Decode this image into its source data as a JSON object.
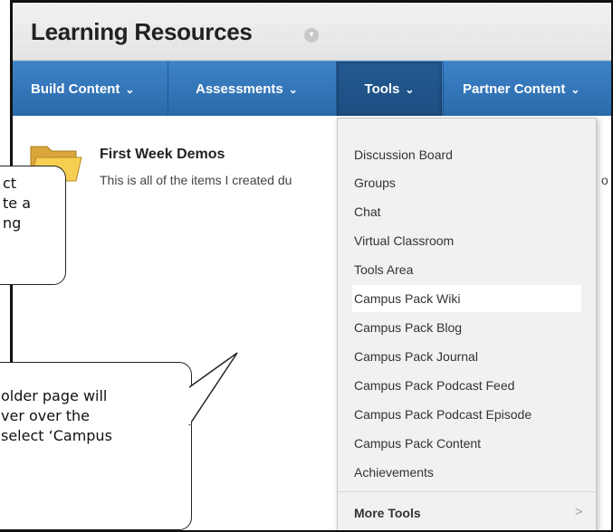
{
  "header": {
    "title": "Learning Resources"
  },
  "nav": {
    "items": [
      {
        "label": "Build Content"
      },
      {
        "label": "Assessments"
      },
      {
        "label": "Tools"
      },
      {
        "label": "Partner Content"
      }
    ]
  },
  "content": {
    "item_title": "First Week Demos",
    "item_desc": "This is all of the items I created du",
    "item_desc_tail": "o"
  },
  "tools_menu": {
    "items": [
      "Discussion Board",
      "Groups",
      "Chat",
      "Virtual Classroom",
      "Tools Area",
      "Campus Pack Wiki",
      "Campus Pack Blog",
      "Campus Pack Journal",
      "Campus Pack Podcast Feed",
      "Campus Pack Podcast Episode",
      "Campus Pack Content",
      "Achievements"
    ],
    "highlighted": "Campus Pack Wiki",
    "more": "More Tools"
  },
  "callouts": {
    "first": [
      "ct",
      "te a",
      "ng"
    ],
    "second": [
      "older page will",
      "ver over the",
      "select ‘Campus"
    ]
  },
  "colors": {
    "nav_bg": "#2f72b5",
    "highlight": "#ffffff",
    "menu_bg": "#f1f1f1"
  }
}
